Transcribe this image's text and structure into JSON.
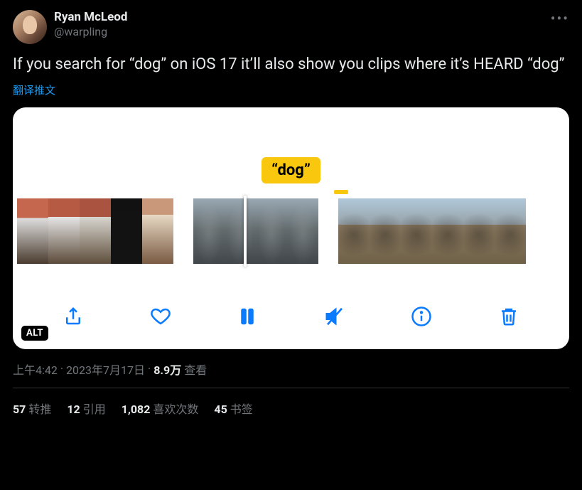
{
  "author": {
    "display_name": "Ryan McLeod",
    "handle": "@warpling"
  },
  "tweet_text": "If you search for “dog” on iOS 17 it’ll also show you clips where it’s HEARD “dog”",
  "translate_label": "翻译推文",
  "media": {
    "search_term_display": "“dog”",
    "alt_badge": "ALT",
    "controls": {
      "share": "share",
      "like": "like",
      "pause": "pause",
      "mute": "mute",
      "info": "info",
      "delete": "delete"
    }
  },
  "meta": {
    "time": "上午4:42",
    "dot1": " · ",
    "date": "2023年7月17日",
    "dot2": " · ",
    "views_value": "8.9万",
    "views_label": " 查看"
  },
  "stats": {
    "retweets": {
      "count": "57",
      "label": "转推"
    },
    "quotes": {
      "count": "12",
      "label": "引用"
    },
    "likes": {
      "count": "1,082",
      "label": "喜欢次数"
    },
    "bookmarks": {
      "count": "45",
      "label": "书签"
    }
  }
}
